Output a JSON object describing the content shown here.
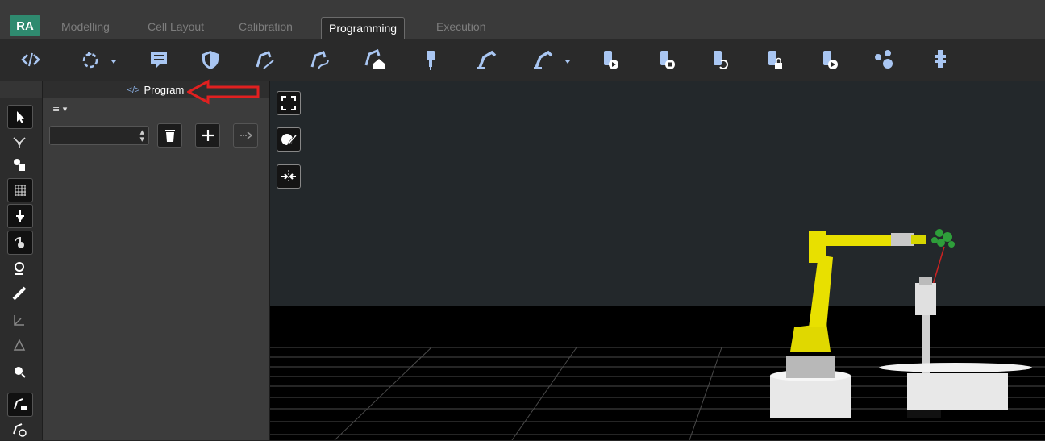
{
  "app": {
    "logo": "RA"
  },
  "tabs": [
    {
      "label": "Modelling",
      "active": false
    },
    {
      "label": "Cell Layout",
      "active": false
    },
    {
      "label": "Calibration",
      "active": false
    },
    {
      "label": "Programming",
      "active": true
    },
    {
      "label": "Execution",
      "active": false
    }
  ],
  "toolbar": {
    "icons": [
      "code-icon",
      "rotate-target-icon",
      "comment-icon",
      "safety-shield-icon",
      "robot-path-icon",
      "robot-curve-icon",
      "robot-home-icon",
      "tool-icon",
      "robot-arm-icon",
      "robot-arm-dropdown-icon",
      "tracker-play-icon",
      "tracker-stop-icon",
      "tracker-refresh-icon",
      "tracker-lock-icon",
      "tracker-run-icon",
      "network-icon",
      "probe-icon"
    ]
  },
  "left_tools": [
    "pointer-icon",
    "target-icon",
    "object-icon",
    "grid-icon",
    "move-icon",
    "rotate-icon",
    "location-icon",
    "ruler-icon",
    "frame-icon",
    "plane-icon",
    "part-icon",
    "robot-lock-icon",
    "robot-add-icon"
  ],
  "panel": {
    "title": "Program",
    "title_icon": "</>",
    "menu_label": "≡ ▾",
    "program_select": {
      "value": ""
    }
  },
  "viewport": {
    "buttons": [
      "fullscreen-icon",
      "paint-icon",
      "fit-icon"
    ]
  },
  "colors": {
    "accent": "#2f8a6f",
    "toolbar_icon": "#a9c6f2",
    "annotation": "#e02020",
    "robot": "#e8e000",
    "target_green": "#2e9e3a"
  }
}
